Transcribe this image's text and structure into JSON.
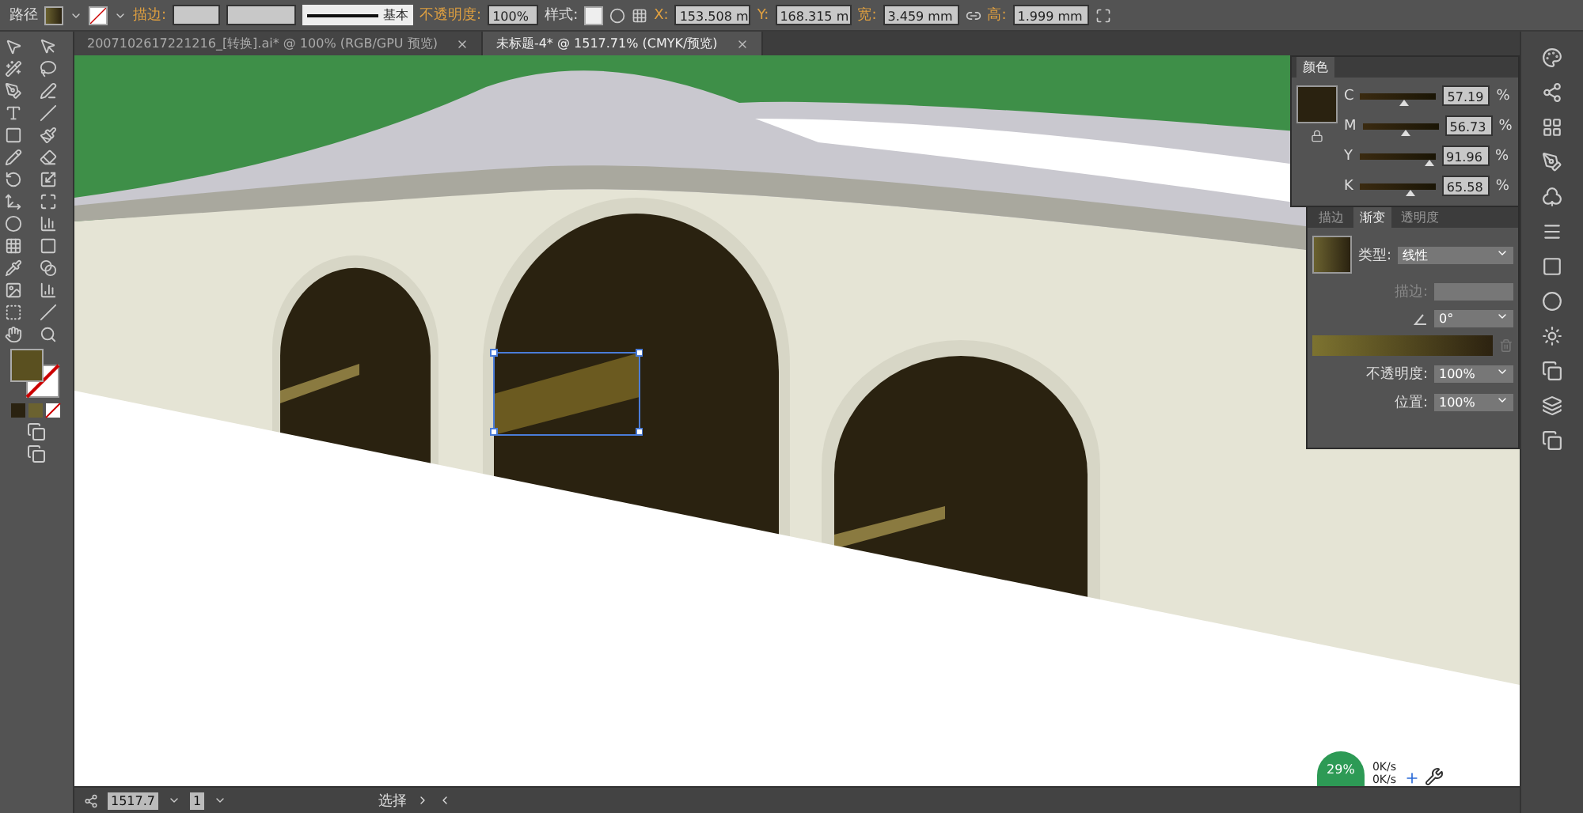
{
  "control_bar": {
    "object_type": "路径",
    "stroke_label": "描边:",
    "stroke_profile": "基本",
    "opacity_label": "不透明度:",
    "opacity": "100%",
    "style_label": "样式:",
    "x_label": "X:",
    "y_label": "Y:",
    "width_label": "宽:",
    "height_label": "高:",
    "x": "153.508 m",
    "y": "168.315 m",
    "width": "3.459 mm",
    "height": "1.999 mm"
  },
  "tabs": [
    {
      "label": "2007102617221216_[转换].ai* @ 100% (RGB/GPU 预览)",
      "selected": false
    },
    {
      "label": "未标题-4* @ 1517.71% (CMYK/预览)",
      "selected": true
    }
  ],
  "color_panel": {
    "title": "颜色",
    "channels": [
      {
        "name": "C",
        "value": "57.19",
        "percent": "%",
        "level": 0.57
      },
      {
        "name": "M",
        "value": "56.73",
        "percent": "%",
        "level": 0.57
      },
      {
        "name": "Y",
        "value": "91.96",
        "percent": "%",
        "level": 0.92
      },
      {
        "name": "K",
        "value": "65.58",
        "percent": "%",
        "level": 0.66
      }
    ]
  },
  "gradient_panel": {
    "tabs": [
      {
        "label": "描边",
        "selected": false
      },
      {
        "label": "渐变",
        "selected": true
      },
      {
        "label": "透明度",
        "selected": false
      }
    ],
    "type_label": "类型:",
    "type": "线性",
    "stroke_label": "描边:",
    "angle": "0°",
    "opacity_label": "不透明度:",
    "opacity": "100%",
    "location_label": "位置:",
    "location": "100%"
  },
  "status_bar": {
    "zoom": "1517.7",
    "artboard": "1",
    "tool": "选择"
  },
  "network_monitor": {
    "cpu": "29%",
    "upload": "0K/s",
    "download": "0K/s"
  }
}
